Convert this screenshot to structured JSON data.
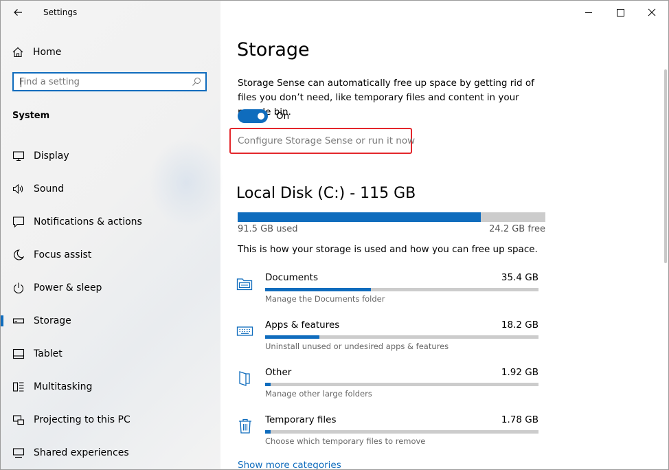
{
  "window": {
    "title": "Settings",
    "controls": {
      "minimize": "minimize",
      "maximize": "maximize",
      "close": "close"
    }
  },
  "sidebar": {
    "home_label": "Home",
    "search": {
      "placeholder": "Find a setting",
      "value": ""
    },
    "section_title": "System",
    "items": [
      {
        "label": "Display",
        "icon": "display-icon"
      },
      {
        "label": "Sound",
        "icon": "speaker-icon"
      },
      {
        "label": "Notifications & actions",
        "icon": "notification-icon"
      },
      {
        "label": "Focus assist",
        "icon": "moon-icon"
      },
      {
        "label": "Power & sleep",
        "icon": "power-icon"
      },
      {
        "label": "Storage",
        "icon": "storage-icon",
        "active": true
      },
      {
        "label": "Tablet",
        "icon": "tablet-icon"
      },
      {
        "label": "Multitasking",
        "icon": "multitasking-icon"
      },
      {
        "label": "Projecting to this PC",
        "icon": "projecting-icon"
      },
      {
        "label": "Shared experiences",
        "icon": "shared-experiences-icon"
      }
    ]
  },
  "main": {
    "title": "Storage",
    "description": "Storage Sense can automatically free up space by getting rid of files you don’t need, like temporary files and content in your recycle bin.",
    "storage_sense": {
      "state": "on",
      "label": "On"
    },
    "configure_link": "Configure Storage Sense or run it now",
    "disk": {
      "title": "Local Disk (C:) - 115 GB",
      "used_label": "91.5 GB used",
      "free_label": "24.2 GB free",
      "used_fraction": 0.79
    },
    "usage_intro": "This is how your storage is used and how you can free up space.",
    "categories": [
      {
        "name": "Documents",
        "size": "35.4 GB",
        "subtitle": "Manage the Documents folder",
        "fraction": 0.387,
        "icon": "documents-folder-icon"
      },
      {
        "name": "Apps & features",
        "size": "18.2 GB",
        "subtitle": "Uninstall unused or undesired apps & features",
        "fraction": 0.199,
        "icon": "apps-keyboard-icon"
      },
      {
        "name": "Other",
        "size": "1.92 GB",
        "subtitle": "Manage other large folders",
        "fraction": 0.021,
        "icon": "other-folder-icon"
      },
      {
        "name": "Temporary files",
        "size": "1.78 GB",
        "subtitle": "Choose which temporary files to remove",
        "fraction": 0.019,
        "icon": "trash-icon"
      }
    ],
    "show_more_link": "Show more categories"
  },
  "colors": {
    "accent": "#0f6cbd",
    "highlight": "#e3262b",
    "bar_track": "#cccccc"
  }
}
